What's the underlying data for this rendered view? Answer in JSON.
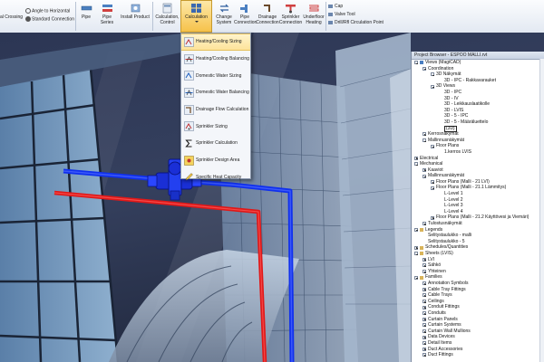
{
  "ribbon": {
    "left_group": [
      {
        "label": "Angle to Horizontal"
      },
      {
        "label": "Standard Connection"
      }
    ],
    "crossing_label": "al Crossing",
    "buttons": [
      {
        "label": "Pipe"
      },
      {
        "label": "Pipe Series"
      },
      {
        "label": "Install Product"
      },
      {
        "label": "Calculation, Control"
      },
      {
        "label": "Calculation"
      },
      {
        "label": "Change System"
      },
      {
        "label": "Pipe Connection"
      },
      {
        "label": "Drainage Connection"
      },
      {
        "label": "Sprinkler Connection"
      },
      {
        "label": "Underfloor Heating"
      }
    ],
    "right_group": [
      {
        "label": "Cap"
      },
      {
        "label": "Valve Tool"
      },
      {
        "label": "Drill/Rfl Circulation Point"
      }
    ]
  },
  "menu": {
    "items": [
      {
        "label": "Heating/Cooling Sizing",
        "highlighted": true
      },
      {
        "label": "Heating/Cooling Balancing",
        "highlighted": false
      },
      {
        "label": "Domestic Water Sizing",
        "highlighted": false
      },
      {
        "label": "Domestic Water Balancing",
        "highlighted": false
      },
      {
        "label": "Drainage Flow Calculation",
        "highlighted": false
      },
      {
        "label": "Sprinkler Sizing",
        "highlighted": false
      },
      {
        "label": "Sprinkler Calculation",
        "highlighted": false
      },
      {
        "label": "Sprinkler Design Area",
        "highlighted": false
      },
      {
        "label": "Specific Heat Capacity",
        "highlighted": false
      }
    ]
  },
  "project_browser": {
    "title": "Project Browser - ESPOO MALLI.rvt",
    "tree": [
      {
        "label": "Views (MagiCAD)",
        "level": 0,
        "exp": "minus",
        "icon": "view"
      },
      {
        "label": "Coordination",
        "level": 1,
        "exp": "minus"
      },
      {
        "label": "3D Näkymät",
        "level": 2,
        "exp": "minus"
      },
      {
        "label": "3D - IPC - Rakkavarauket",
        "level": 3
      },
      {
        "label": "3D Views",
        "level": 2,
        "exp": "minus"
      },
      {
        "label": "3D - IPC",
        "level": 3
      },
      {
        "label": "3D - IV",
        "level": 3
      },
      {
        "label": "3D - Leikkauslaatikolle",
        "level": 3
      },
      {
        "label": "3D - LVIS",
        "level": 3
      },
      {
        "label": "3D - 5 - IPC",
        "level": 3
      },
      {
        "label": "3D - 5 - Määräluettelo",
        "level": 3
      },
      {
        "label": "{3D}",
        "level": 3,
        "selected": true
      },
      {
        "label": "Kerrosnäkymät",
        "level": 1,
        "exp": "plus"
      },
      {
        "label": "Mallinnusnäkymät",
        "level": 1,
        "exp": "minus"
      },
      {
        "label": "Floor Plans",
        "level": 2,
        "exp": "minus"
      },
      {
        "label": "1.kerros LVIS",
        "level": 3
      },
      {
        "label": "Electrical",
        "level": 0,
        "exp": "plus"
      },
      {
        "label": "Mechanical",
        "level": 0,
        "exp": "minus"
      },
      {
        "label": "Kaaviot",
        "level": 1,
        "exp": "plus"
      },
      {
        "label": "Mallinnusnäkymät",
        "level": 1,
        "exp": "minus"
      },
      {
        "label": "Floor Plans (Malli - 21 LVI)",
        "level": 2,
        "exp": "plus"
      },
      {
        "label": "Floor Plans (Malli - 21.1 Lämmitys)",
        "level": 2,
        "exp": "minus"
      },
      {
        "label": "L-Level 1",
        "level": 3
      },
      {
        "label": "L-Level 2",
        "level": 3
      },
      {
        "label": "L-Level 3",
        "level": 3
      },
      {
        "label": "L-Level 4",
        "level": 3
      },
      {
        "label": "Floor Plans (Malli - 21.2 Käyttövesi ja Viemäri)",
        "level": 2,
        "exp": "plus"
      },
      {
        "label": "Tulostusnäkymät",
        "level": 1,
        "exp": "plus"
      },
      {
        "label": "Legends",
        "level": 0,
        "exp": "minus",
        "icon": "folder"
      },
      {
        "label": "Selitystaulukko - malli",
        "level": 1
      },
      {
        "label": "Selitystaulukko - 5",
        "level": 1
      },
      {
        "label": "Schedules/Quantities",
        "level": 0,
        "exp": "plus",
        "icon": "folder"
      },
      {
        "label": "Sheets (LVIS)",
        "level": 0,
        "exp": "minus",
        "icon": "folder"
      },
      {
        "label": "LVI",
        "level": 1,
        "exp": "plus"
      },
      {
        "label": "Sähkö",
        "level": 1,
        "exp": "plus"
      },
      {
        "label": "Yhteinen",
        "level": 1,
        "exp": "plus"
      },
      {
        "label": "Families",
        "level": 0,
        "exp": "minus",
        "icon": "folder"
      },
      {
        "label": "Annotation Symbols",
        "level": 1,
        "exp": "plus"
      },
      {
        "label": "Cable Tray Fittings",
        "level": 1,
        "exp": "plus"
      },
      {
        "label": "Cable Trays",
        "level": 1,
        "exp": "plus"
      },
      {
        "label": "Ceilings",
        "level": 1,
        "exp": "plus"
      },
      {
        "label": "Conduit Fittings",
        "level": 1,
        "exp": "plus"
      },
      {
        "label": "Conduits",
        "level": 1,
        "exp": "plus"
      },
      {
        "label": "Curtain Panels",
        "level": 1,
        "exp": "plus"
      },
      {
        "label": "Curtain Systems",
        "level": 1,
        "exp": "plus"
      },
      {
        "label": "Curtain Wall Mullions",
        "level": 1,
        "exp": "plus"
      },
      {
        "label": "Data Devices",
        "level": 1,
        "exp": "plus"
      },
      {
        "label": "Detail Items",
        "level": 1,
        "exp": "plus"
      },
      {
        "label": "Duct Accessories",
        "level": 1,
        "exp": "plus"
      },
      {
        "label": "Duct Fittings",
        "level": 1,
        "exp": "plus"
      }
    ]
  },
  "colors": {
    "supply_pipe": "#1030ee",
    "return_pipe": "#e01818",
    "menu_highlight": "#fde39a",
    "ribbon_active": "#f6c24a"
  }
}
